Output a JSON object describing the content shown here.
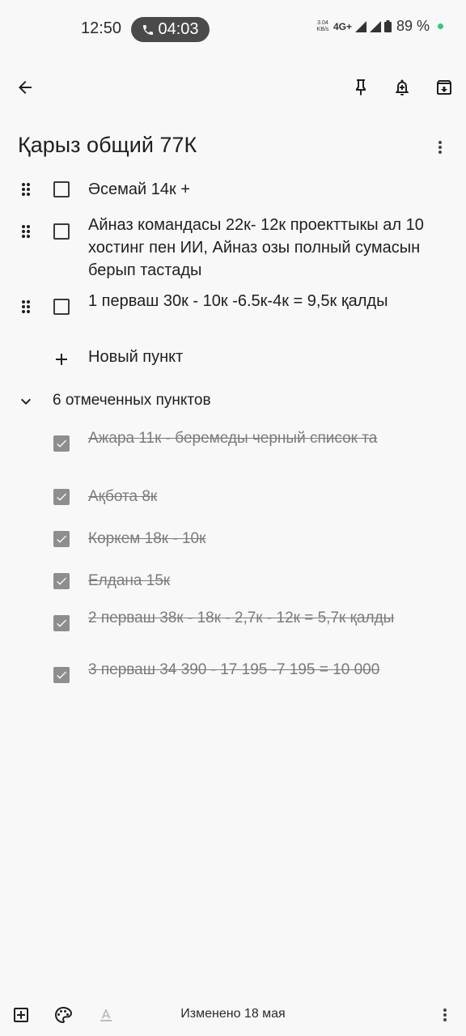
{
  "status_bar": {
    "time": "12:50",
    "call_timer": "04:03",
    "net_speed": "3.04 KB/s",
    "network": "4G+",
    "battery": "89 %"
  },
  "toolbar": {
    "back_icon": "arrow-left-icon",
    "pin_icon": "pin-icon",
    "reminder_icon": "bell-plus-icon",
    "archive_icon": "archive-icon"
  },
  "note": {
    "title": "Қарыз общий 77К",
    "unchecked": [
      {
        "text": "Әсемай 14к +"
      },
      {
        "text": "Айназ командасы 22к- 12к проекттыкы ал 10 хостинг пен ИИ, Айназ озы полный сумасын берып тастады"
      },
      {
        "text": "1 перваш 30к - 10к -6.5к-4к = 9,5к қалды"
      }
    ],
    "new_item_label": "Новый пункт",
    "checked_header": "6 отмеченных пунктов",
    "checked": [
      {
        "text": "Ажара 11к - беремеды черный список та"
      },
      {
        "text": "Ақбота 8к"
      },
      {
        "text": "Көркем 18к - 10к"
      },
      {
        "text": "Елдана 15к"
      },
      {
        "text": "2 перваш 38к - 18к - 2,7к - 12к = 5,7к қалды"
      },
      {
        "text": "3 перваш 34 390 - 17 195 -7 195 = 10 000"
      }
    ]
  },
  "bottom_bar": {
    "edited": "Изменено 18 мая",
    "add_icon": "add-box-icon",
    "palette_icon": "palette-icon",
    "text_format_icon": "text-format-icon",
    "more_icon": "more-vert-icon"
  }
}
